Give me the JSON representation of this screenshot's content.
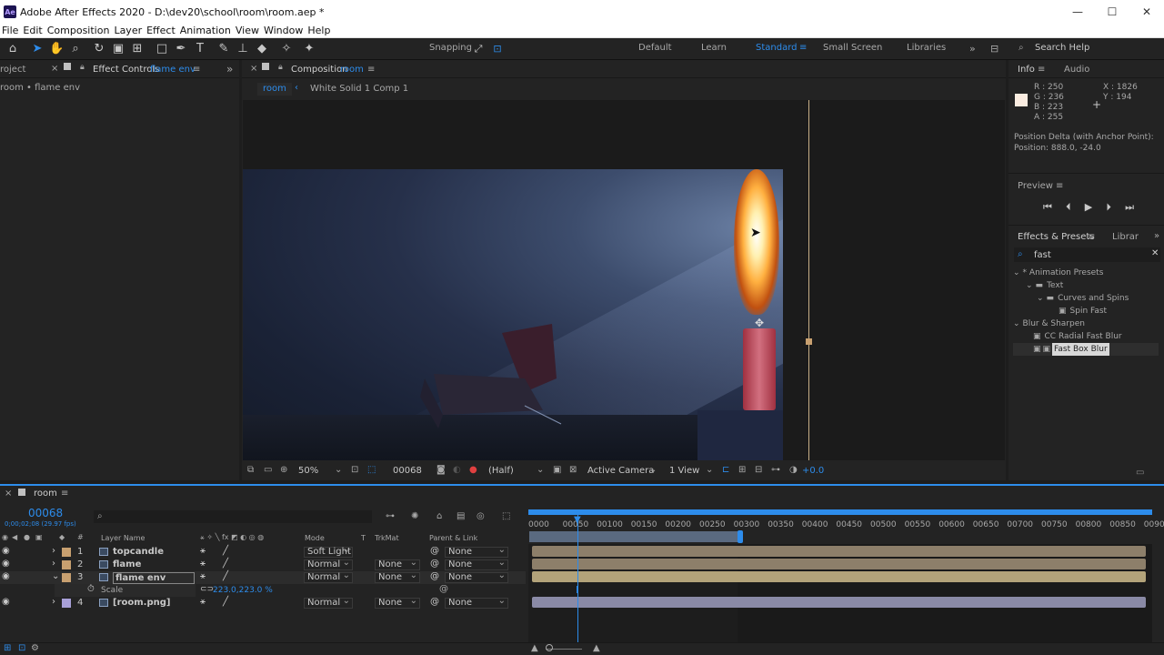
{
  "window": {
    "app_badge": "Ae",
    "title": "Adobe After Effects 2020 - D:\\dev20\\school\\room\\room.aep *",
    "minimize": "—",
    "maximize": "☐",
    "close": "✕"
  },
  "menu": [
    "File",
    "Edit",
    "Composition",
    "Layer",
    "Effect",
    "Animation",
    "View",
    "Window",
    "Help"
  ],
  "toolbar": {
    "snapping_label": "Snapping",
    "workspaces": [
      "Default",
      "Learn",
      "Standard",
      "Small Screen",
      "Libraries"
    ],
    "active_workspace": "Standard",
    "search_help_placeholder": "Search Help"
  },
  "left_panel": {
    "project_tab": "roject",
    "effect_controls_tab": "Effect Controls",
    "effect_controls_layer": "flame env",
    "breadcrumb": "room • flame env"
  },
  "composition": {
    "tab_label": "Composition",
    "tab_comp": "room",
    "crumb_active": "room",
    "crumb_next": "White Solid 1 Comp 1",
    "zoom": "50%",
    "timecode": "00068",
    "resolution": "(Half)",
    "camera": "Active Camera",
    "views": "1 View",
    "exposure": "+0.0"
  },
  "info": {
    "tab_info": "Info",
    "tab_audio": "Audio",
    "r": "R : 250",
    "g": "G : 236",
    "b": "B : 223",
    "a": "A : 255",
    "x": "X : 1826",
    "y": "Y : 194",
    "delta_label": "Position Delta (with Anchor Point):",
    "delta_value": "Position: 888.0, -24.0",
    "color": "#faece0"
  },
  "preview": {
    "title": "Preview"
  },
  "effects_presets": {
    "tab": "Effects & Presets",
    "tab2": "Librar",
    "search_value": "fast",
    "tree": [
      {
        "label": "* Animation Presets",
        "indent": 0
      },
      {
        "label": "Text",
        "indent": 1
      },
      {
        "label": "Curves and Spins",
        "indent": 2
      },
      {
        "label": "Spin Fast",
        "indent": 3
      },
      {
        "label": "Blur & Sharpen",
        "indent": 0
      },
      {
        "label": "CC Radial Fast Blur",
        "indent": 1
      },
      {
        "label": "Fast Box Blur",
        "indent": 1
      }
    ]
  },
  "timeline": {
    "comp_tab": "room",
    "timecode": "00068",
    "timecode_sub": "0;00;02;08 (29.97 fps)",
    "col_layer_name": "Layer Name",
    "col_mode": "Mode",
    "col_t": "T",
    "col_trkmat": "TrkMat",
    "col_parent": "Parent & Link",
    "ruler": [
      "0000",
      "00050",
      "00100",
      "00150",
      "00200",
      "00250",
      "00300",
      "00350",
      "00400",
      "00450",
      "00500",
      "00550",
      "00600",
      "00650",
      "00700",
      "00750",
      "00800",
      "00850",
      "0090"
    ],
    "layers": [
      {
        "num": "1",
        "name": "topcandle",
        "mode": "Soft Light",
        "trkmat": "",
        "parent": "None",
        "label_color": "#c8a070"
      },
      {
        "num": "2",
        "name": "flame",
        "mode": "Normal",
        "trkmat": "None",
        "parent": "None",
        "label_color": "#c8a070"
      },
      {
        "num": "3",
        "name": "flame env",
        "mode": "Normal",
        "trkmat": "None",
        "parent": "None",
        "label_color": "#c8a070"
      },
      {
        "num": "4",
        "name": "[room.png]",
        "mode": "Normal",
        "trkmat": "None",
        "parent": "None",
        "label_color": "#a8a0d8"
      }
    ],
    "scale_label": "Scale",
    "scale_value": "223.0,223.0 %"
  }
}
